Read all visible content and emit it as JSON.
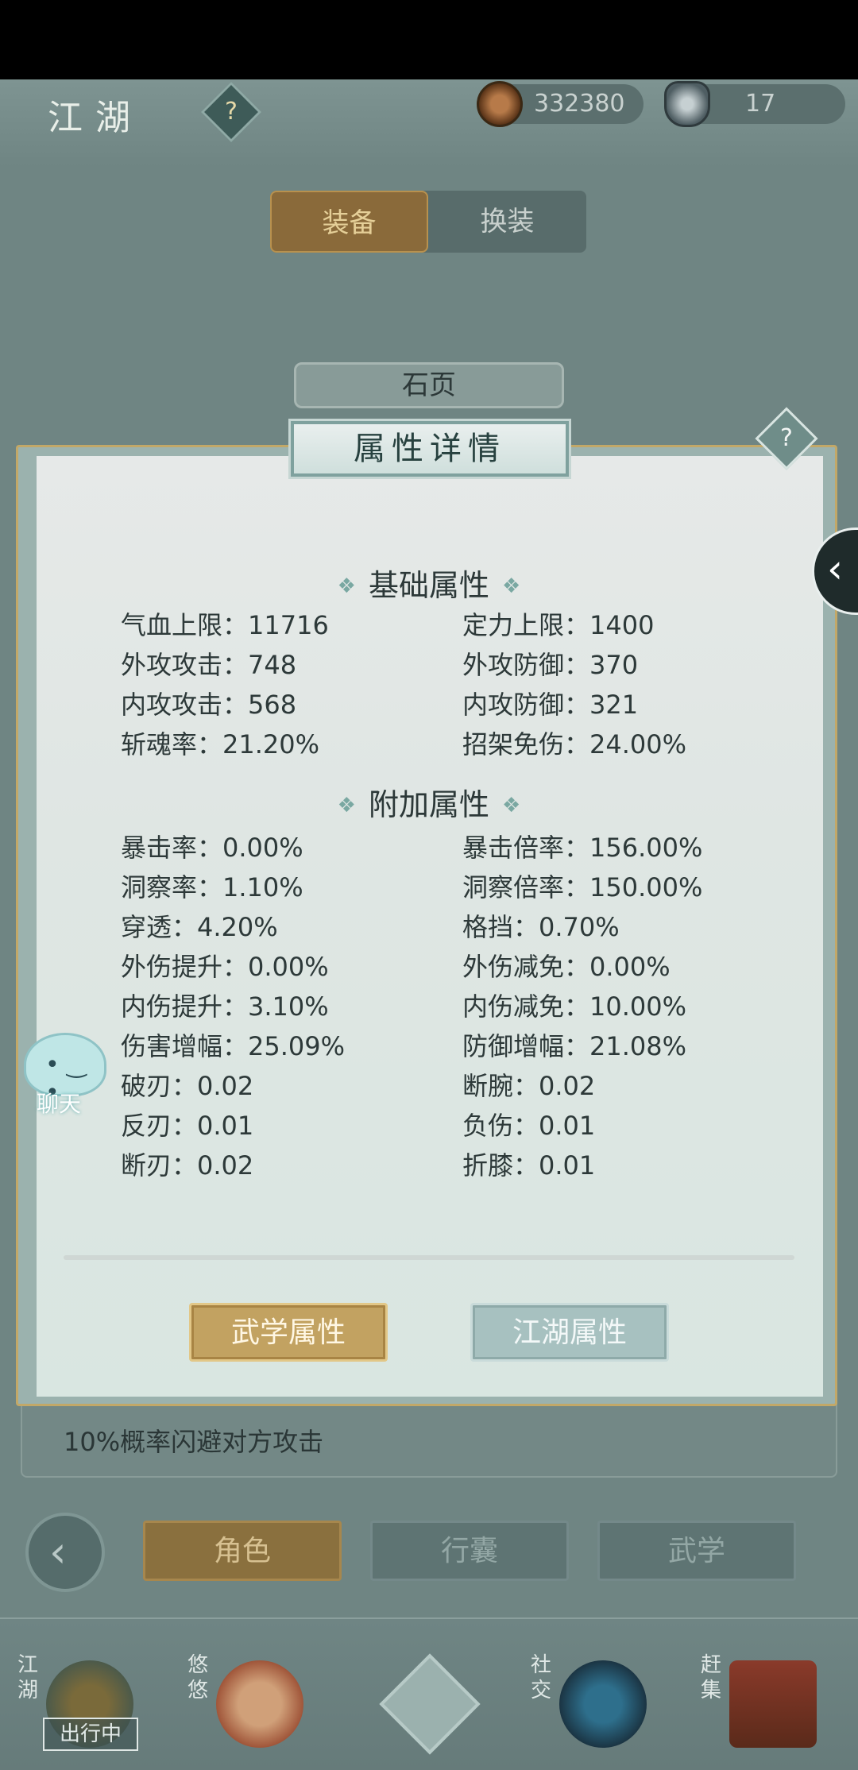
{
  "header": {
    "title": "江湖",
    "copper": "332380",
    "silver": "17"
  },
  "top_tabs": [
    "装备",
    "换装"
  ],
  "item_name": "石页",
  "modal": {
    "title": "属性详情",
    "basic_title": "基础属性",
    "basic_stats": [
      {
        "label": "气血上限：11716"
      },
      {
        "label": "定力上限：1400"
      },
      {
        "label": "外攻攻击：748"
      },
      {
        "label": "外攻防御：370"
      },
      {
        "label": "内攻攻击：568"
      },
      {
        "label": "内攻防御：321"
      },
      {
        "label": "斩魂率：21.20%"
      },
      {
        "label": "招架免伤：24.00%"
      }
    ],
    "extra_title": "附加属性",
    "extra_stats": [
      {
        "label": "暴击率：0.00%"
      },
      {
        "label": "暴击倍率：156.00%"
      },
      {
        "label": "洞察率：1.10%"
      },
      {
        "label": "洞察倍率：150.00%"
      },
      {
        "label": "穿透：4.20%"
      },
      {
        "label": "格挡：0.70%"
      },
      {
        "label": "外伤提升：0.00%"
      },
      {
        "label": "外伤减免：0.00%"
      },
      {
        "label": "内伤提升：3.10%"
      },
      {
        "label": "内伤减免：10.00%"
      },
      {
        "label": "伤害增幅：25.09%"
      },
      {
        "label": "防御增幅：21.08%"
      },
      {
        "label": "破刃：0.02"
      },
      {
        "label": "断腕：0.02"
      },
      {
        "label": "反刃：0.01"
      },
      {
        "label": "负伤：0.01"
      },
      {
        "label": "断刃：0.02"
      },
      {
        "label": "折膝：0.01"
      }
    ],
    "buttons": [
      "武学属性",
      "江湖属性"
    ]
  },
  "chat_label": "聊天",
  "description": "10%概率闪避对方攻击",
  "bottom_tabs": [
    "角色",
    "行囊",
    "武学"
  ],
  "dock": {
    "item1_label": "江湖",
    "item1_badge": "出行中",
    "item2_label": "悠悠",
    "item4_label": "社交",
    "item5_label": "赶集"
  }
}
